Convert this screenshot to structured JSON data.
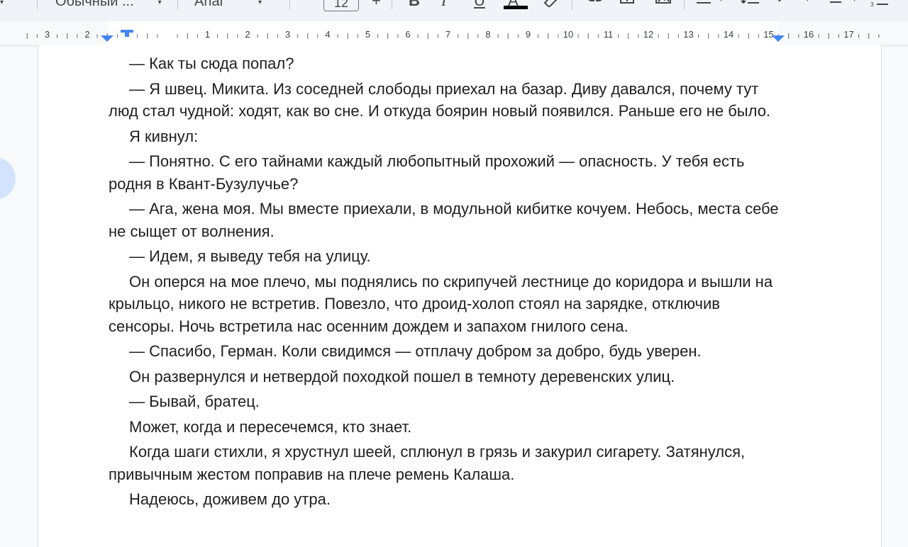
{
  "toolbar": {
    "style_label": "Обычный ...",
    "font_label": "Arial",
    "font_size": "12",
    "plus_label": "+",
    "bold_label": "B",
    "italic_label": "I",
    "underline_label": "U",
    "text_color_label": "A",
    "accent_color": "#0b57d0"
  },
  "ruler": {
    "labels": [
      "3",
      "2",
      "1",
      "2",
      "3",
      "4",
      "5",
      "6",
      "7",
      "8",
      "9",
      "10",
      "11",
      "12",
      "13",
      "14",
      "15",
      "16",
      "17"
    ]
  },
  "document": {
    "paragraphs": [
      "— Как ты сюда попал?",
      "— Я швец. Микита. Из соседней слободы приехал на базар. Диву давался, почему тут люд стал чудной: ходят, как во сне. И откуда боярин новый появился. Раньше его не было.",
      "Я кивнул:",
      "— Понятно. С его тайнами каждый любопытный прохожий — опасность. У тебя есть родня в Квант-Бузулучье?",
      "— Ага, жена моя. Мы вместе приехали, в модульной кибитке кочуем. Небось, места себе не сыщет от волнения.",
      "— Идем, я выведу тебя на улицу.",
      "Он оперся на мое плечо, мы поднялись по скрипучей лестнице до коридора и вышли на крыльцо, никого не встретив. Повезло, что дроид-холоп стоял на зарядке, отключив сенсоры. Ночь встретила нас осенним дождем и запахом гнилого сена.",
      "— Спасибо, Герман. Коли свидимся — отплачу добром за добро, будь уверен.",
      "Он развернулся и нетвердой походкой пошел в темноту деревенских улиц.",
      "— Бывай, братец.",
      "Может, когда и пересечемся, кто знает.",
      "Когда шаги стихли, я хрустнул шеей, сплюнул в грязь и закурил сигарету. Затянулся, привычным жестом поправив на плече ремень Калаша.",
      "Надеюсь, доживем до утра."
    ]
  }
}
